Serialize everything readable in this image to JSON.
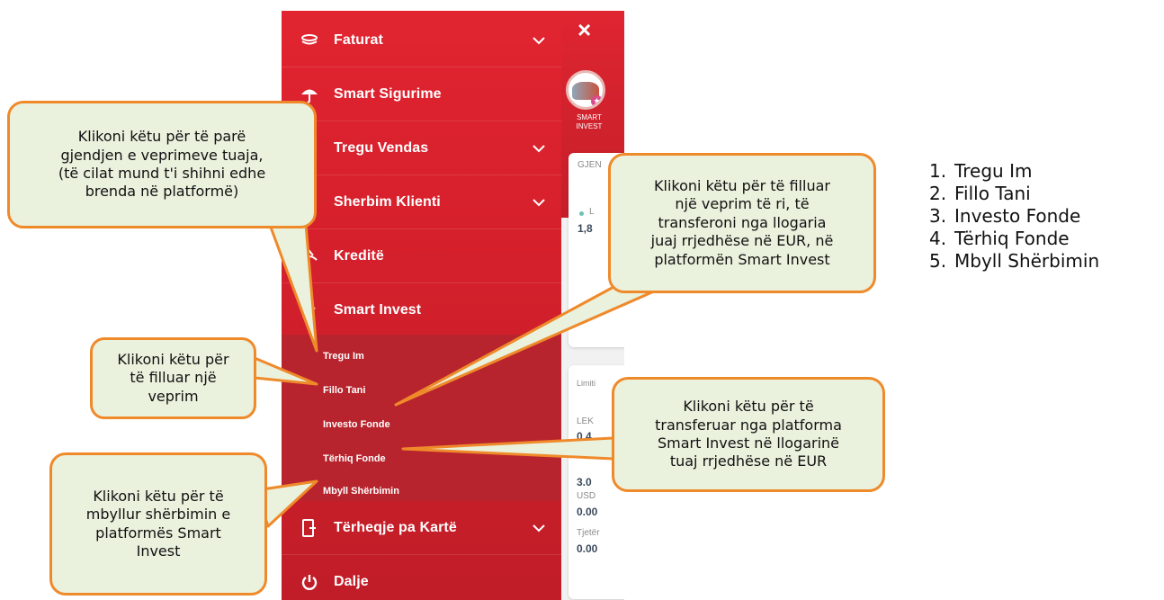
{
  "menu": {
    "items": [
      {
        "label": "Faturat",
        "icon": "coins-icon",
        "chevron": true
      },
      {
        "label": "Smart Sigurime",
        "icon": "umbrella-icon",
        "chevron": false
      },
      {
        "label": "Tregu Vendas",
        "icon": "market-icon",
        "chevron": true
      },
      {
        "label": "Sherbim Klienti",
        "icon": "support-icon",
        "chevron": true
      },
      {
        "label": "Kreditë",
        "icon": "hand-coin-icon",
        "chevron": false
      },
      {
        "label": "Smart Invest",
        "icon": "chevron-up-icon",
        "chevron": false
      },
      {
        "label": "Tërheqje pa Kartë",
        "icon": "cardless-withdraw-icon",
        "chevron": true
      },
      {
        "label": "Dalje",
        "icon": "power-icon",
        "chevron": false
      }
    ],
    "submenu": [
      "Tregu Im",
      "Fillo Tani",
      "Investo Fonde",
      "Tërhiq Fonde",
      "Mbyll Shërbimin"
    ]
  },
  "app": {
    "close_label": "×",
    "logo_label": "SMART\nINVEST",
    "card1_header": "GJEN",
    "card1_label": "L",
    "card1_value": "1,8",
    "card2_header": "Limiti",
    "card2_lek": "LEK",
    "card2_lek_value": "0.4",
    "card2_partial": "3.0",
    "card2_usd": "USD",
    "card2_usd_value": "0.00",
    "card2_other": "Tjetër",
    "card2_other_value": "0.00"
  },
  "callouts": {
    "status": "Klikoni këtu për të parë\ngjendjen e veprimeve tuaja,\n(të cilat mund t'i shihni edhe\nbrenda në platformë)",
    "start": "Klikoni këtu për\ntë filluar një\nveprim",
    "close": "Klikoni këtu për të\nmbyllur shërbimin e\nplatformës Smart\nInvest",
    "invest": "Klikoni këtu për të filluar\nnjë veprim të ri, të\ntransferoni nga llogaria\njuaj rrjedhëse në EUR, në\nplatformën Smart Invest",
    "withdraw": "Klikoni këtu për të\ntransferuar nga platforma\nSmart Invest në llogarinë\ntuaj rrjedhëse në EUR"
  },
  "steps": [
    {
      "num": "1.",
      "label": "Tregu Im"
    },
    {
      "num": "2.",
      "label": "Fillo Tani"
    },
    {
      "num": "3.",
      "label": "Investo Fonde"
    },
    {
      "num": "4.",
      "label": "Tërhiq Fonde"
    },
    {
      "num": "5.",
      "label": "Mbyll Shërbimin"
    }
  ],
  "colors": {
    "menu_red": "#d5202c",
    "submenu_red": "#b8242d",
    "callout_fill": "#eaf1dd",
    "callout_border": "#ef8a2b"
  }
}
